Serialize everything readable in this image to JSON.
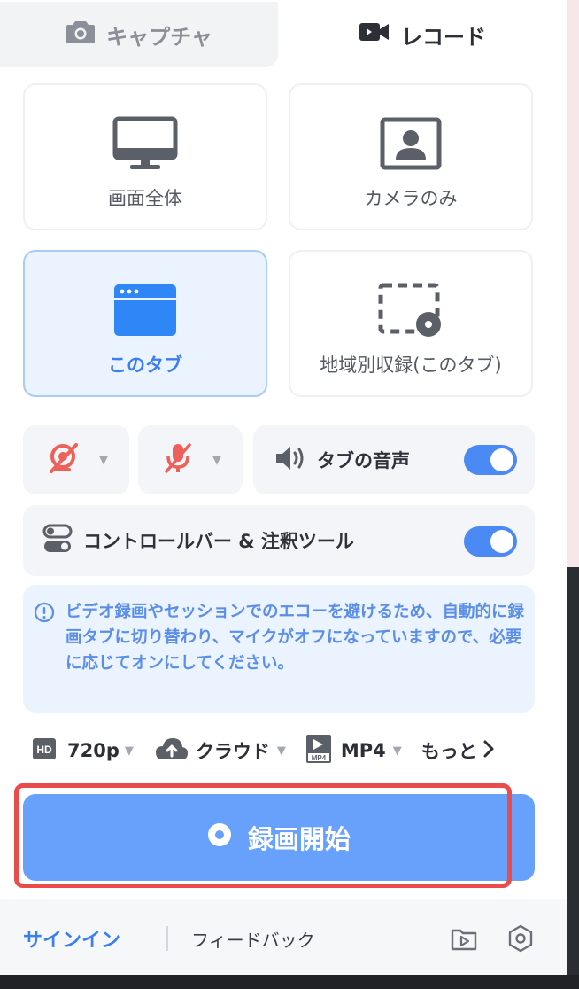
{
  "tabs": {
    "capture": "キャプチャ",
    "record": "レコード"
  },
  "modes": {
    "full_screen": "画面全体",
    "camera_only": "カメラのみ",
    "this_tab": "このタブ",
    "region": "地域別収録(このタブ)"
  },
  "audio": {
    "tab_audio_label": "タブの音声",
    "tab_audio_on": true
  },
  "control_bar": {
    "label": "コントロールバー & 注釈ツール",
    "on": true
  },
  "notice": {
    "text": "ビデオ録画やセッションでのエコーを避けるため、自動的に録画タブに切り替わり、マイクがオフになっていますので、必要に応じてオンにしてください。"
  },
  "options": {
    "quality": "720p",
    "storage": "クラウド",
    "format": "MP4",
    "more": "もっと"
  },
  "record_button": "録画開始",
  "footer": {
    "signin": "サインイン",
    "feedback": "フィードバック"
  },
  "colors": {
    "accent": "#3b7ef0",
    "record_button": "#67a1fb",
    "highlight": "#ea4b4b",
    "muted_icon": "#f0605b"
  }
}
